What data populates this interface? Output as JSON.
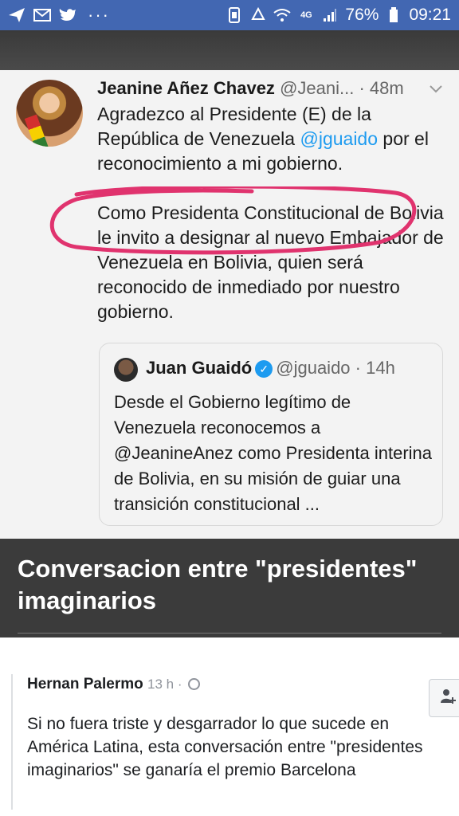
{
  "status_bar": {
    "left_icons": [
      "send-icon",
      "mail-icon",
      "twitter-icon"
    ],
    "more": "···",
    "right_icons": [
      "vibrate-icon",
      "recycle-icon",
      "wifi-icon",
      "network-4g-icon",
      "signal-icon"
    ],
    "network": "4G",
    "battery": "76%",
    "time": "09:21"
  },
  "tweet": {
    "author_name": "Jeanine Añez Chavez",
    "handle": "@Jeani...",
    "age": "· 48m",
    "text_line_1_a": "Agradezco al Presidente (E) de la República de Venezuela ",
    "mention": "@jguaido",
    "text_line_1_b": " por el reconocimiento a mi gobierno.",
    "text_para_2": "Como Presidenta Constitucional de Bolivia le invito a designar al nuevo Embajador de Venezuela en Bolivia, quien será reconocido de inmediado por nuestro gobierno."
  },
  "quoted_tweet": {
    "author_name": "Juan Guaidó",
    "handle": "@jguaido",
    "age": "· 14h",
    "text": "Desde el Gobierno legítimo de Venezuela reconocemos a @JeanineAnez como Presidenta interina de Bolivia, en su misión de guiar una transición constitucional ..."
  },
  "caption": "Conversacion entre \"presidentes\" imaginarios",
  "comment": {
    "author": "Hernan Palermo",
    "time": "13 h ·",
    "text": "Si no fuera triste y desgarrador lo que sucede en América Latina, esta conversación entre \"presidentes imaginarios\" se ganaría el premio Barcelona"
  },
  "colors": {
    "status_bar": "#4267b2",
    "mention": "#1d9bf0",
    "highlight_circle": "#e0336e",
    "caption_band": "#3b3b3b"
  }
}
